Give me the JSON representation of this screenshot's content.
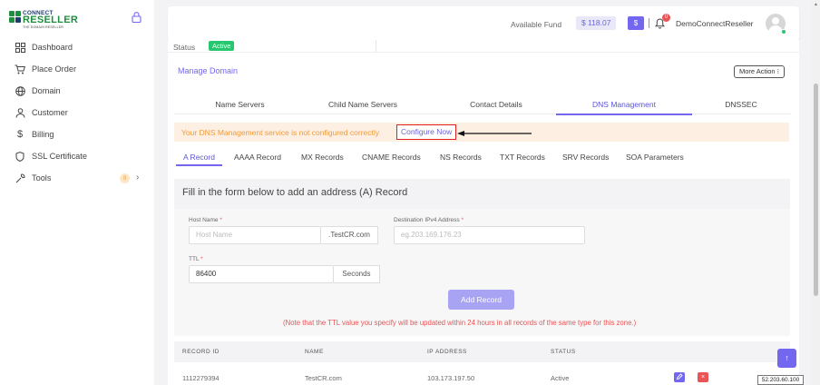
{
  "logo": {
    "line1": "CONNECT",
    "line2": "RESELLER",
    "tagline": "THE DOMAIN RESELLER"
  },
  "sidebar": {
    "items": [
      {
        "label": "Dashboard",
        "icon": "dashboard-icon"
      },
      {
        "label": "Place Order",
        "icon": "cart-icon"
      },
      {
        "label": "Domain",
        "icon": "globe-icon"
      },
      {
        "label": "Customer",
        "icon": "user-icon"
      },
      {
        "label": "Billing",
        "icon": "dollar-icon"
      },
      {
        "label": "SSL Certificate",
        "icon": "shield-icon"
      },
      {
        "label": "Tools",
        "icon": "tools-icon",
        "badge": "9"
      }
    ]
  },
  "header": {
    "fund_label": "Available Fund",
    "fund_value": "$ 118.07",
    "dollar_button": "$",
    "notifications": "0",
    "username": "DemoConnectReseller"
  },
  "domain": {
    "status_label": "Status",
    "status_value": "Active",
    "manage_title": "Manage Domain",
    "more_action": "More Action ⁝"
  },
  "tabs": [
    "Name Servers",
    "Child Name Servers",
    "Contact Details",
    "DNS Management",
    "DNSSEC"
  ],
  "active_tab": "DNS Management",
  "warning": {
    "text": "Your DNS Management service is not configured correctly",
    "link": "Configure Now"
  },
  "record_tabs": [
    "A Record",
    "AAAA Record",
    "MX Records",
    "CNAME Records",
    "NS Records",
    "TXT Records",
    "SRV Records",
    "SOA Parameters"
  ],
  "active_record_tab": "A Record",
  "form": {
    "title": "Fill in the form below to add an address (A) Record",
    "host_label": "Host Name",
    "host_placeholder": "Host Name",
    "host_suffix": ".TestCR.com",
    "dest_label": "Destination IPv4 Address",
    "dest_placeholder": "eg.203.169.176.23",
    "ttl_label": "TTL",
    "ttl_value": "86400",
    "ttl_unit": "Seconds",
    "required_mark": "*",
    "submit": "Add Record",
    "note": "(Note that the TTL value you specify will be updated within 24 hours in all records of the same type for this zone.)"
  },
  "table": {
    "columns": [
      "RECORD ID",
      "NAME",
      "IP ADDRESS",
      "STATUS"
    ],
    "rows": [
      {
        "id": "1112279394",
        "name": "TestCR.com",
        "ip": "103.173.197.50",
        "status": "Active"
      }
    ]
  },
  "tooltip": "52.203.60.100",
  "colors": {
    "accent": "#7367f0",
    "success": "#28c76f",
    "danger": "#ea5455",
    "warning": "#ef9b3e"
  }
}
